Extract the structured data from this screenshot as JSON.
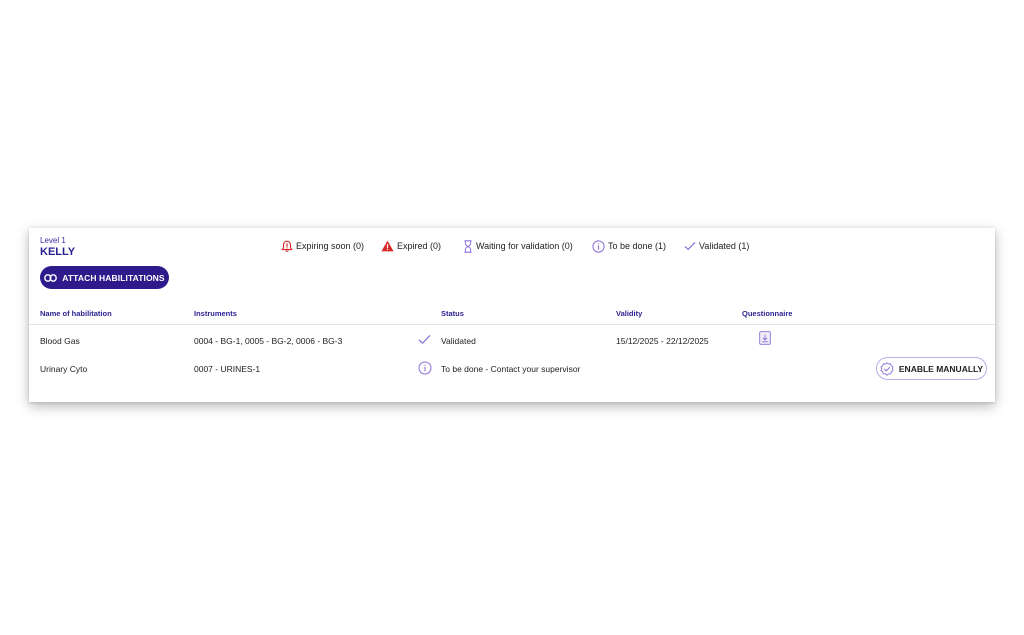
{
  "user": {
    "level": "Level 1",
    "name": "KELLY"
  },
  "legend": [
    {
      "icon": "bell-alert-icon",
      "label": "Expiring soon (0)"
    },
    {
      "icon": "warning-triangle-icon",
      "label": "Expired (0)"
    },
    {
      "icon": "hourglass-icon",
      "label": "Waiting for validation (0)"
    },
    {
      "icon": "info-circle-icon",
      "label": "To be done (1)"
    },
    {
      "icon": "check-icon",
      "label": "Validated (1)"
    }
  ],
  "attach_button": {
    "label": "ATTACH HABILITATIONS",
    "icon": "link-icon"
  },
  "table": {
    "headers": {
      "name": "Name of habilitation",
      "instruments": "Instruments",
      "status": "Status",
      "validity": "Validity",
      "questionnaire": "Questionnaire"
    },
    "rows": [
      {
        "name": "Blood Gas",
        "instruments": "0004 - BG-1, 0005 - BG-2, 0006 - BG-3",
        "status_icon": "check-icon",
        "status": "Validated",
        "validity": "15/12/2025 - 22/12/2025",
        "questionnaire_icon": "download-document-icon"
      },
      {
        "name": "Urinary Cyto",
        "instruments": "0007 - URINES-1",
        "status_icon": "info-circle-icon",
        "status": "To be done - Contact your supervisor",
        "validity": "",
        "action_label": "ENABLE MANUALLY",
        "action_icon": "badge-check-icon"
      }
    ]
  },
  "colors": {
    "primary": "#2e1a8a",
    "accent_light": "#8a6fd8",
    "alert_red": "#d62b2b"
  }
}
